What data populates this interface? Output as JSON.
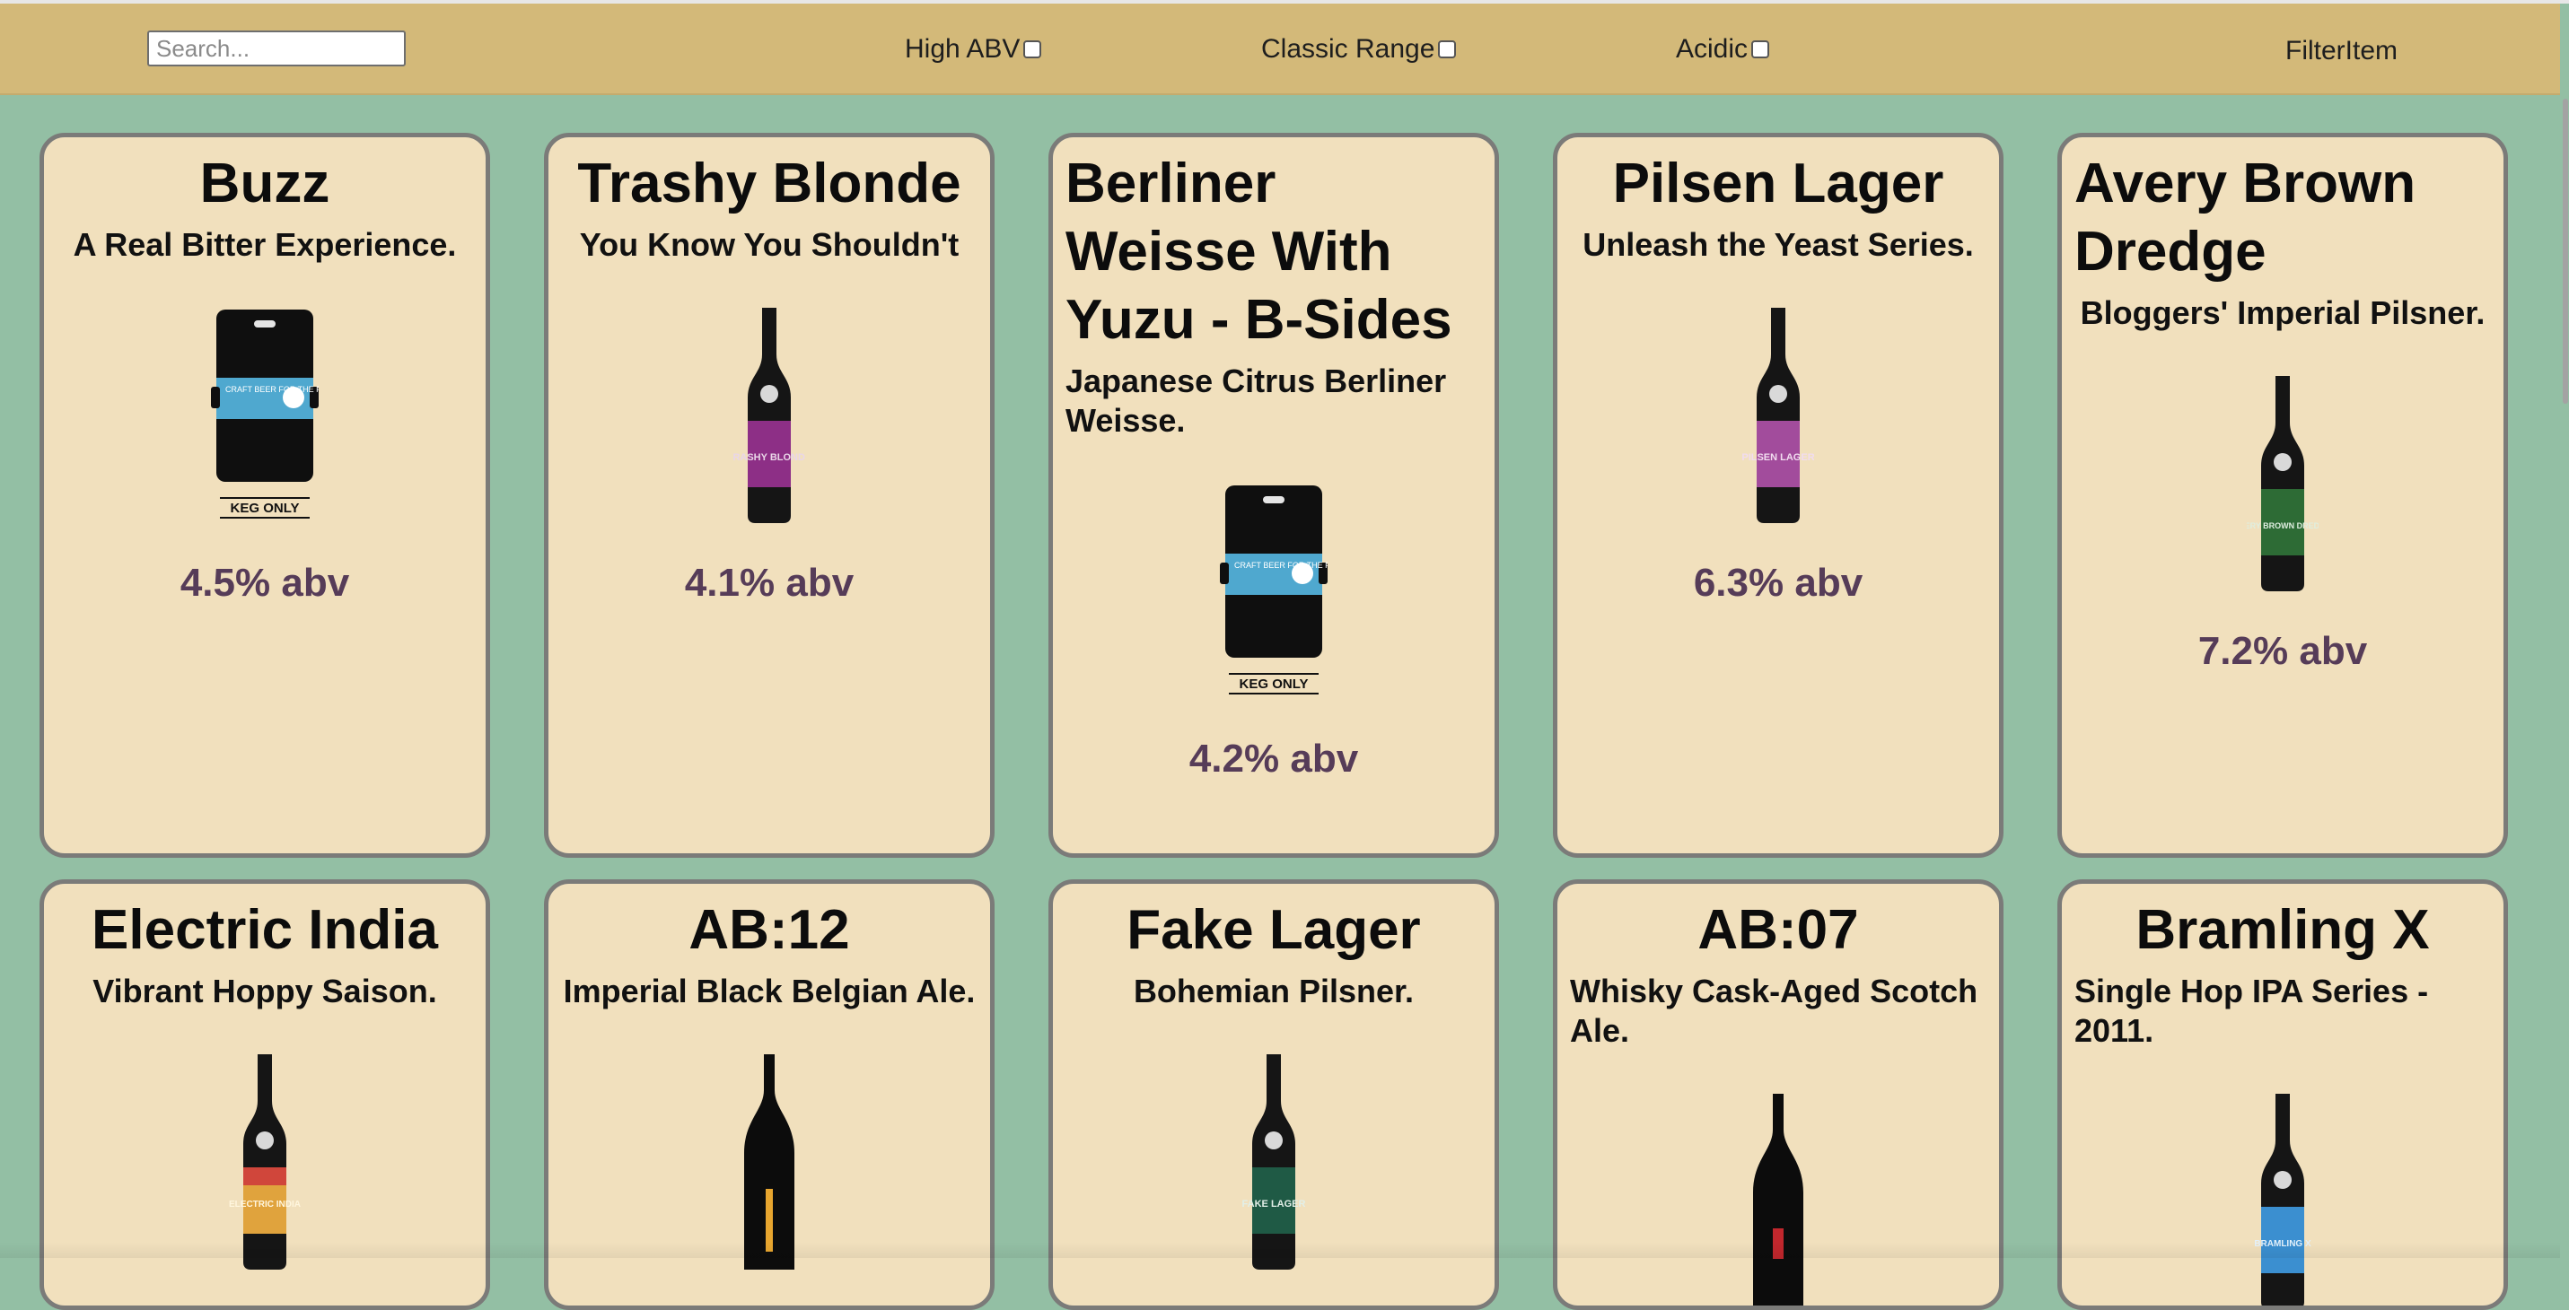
{
  "header": {
    "search_placeholder": "Search...",
    "filters": [
      {
        "label": "High ABV",
        "checked": false
      },
      {
        "label": "Classic Range",
        "checked": false
      },
      {
        "label": "Acidic",
        "checked": false
      }
    ],
    "title": "FilterItem"
  },
  "colors": {
    "background": "#93bfa4",
    "header": "#d3b979",
    "card": "#f1e0bd",
    "card_border": "#7b7b79",
    "abv_text": "#563c58"
  },
  "beers": [
    {
      "name": "Buzz",
      "tagline": "A Real Bitter Experience.",
      "abv": "4.5% abv",
      "image": "keg",
      "keg_label": "KEG ONLY",
      "keg_text": "CRAFT BEER FOR THE PEOPLE"
    },
    {
      "name": "Trashy Blonde",
      "tagline": "You Know You Shouldn't",
      "abv": "4.1% abv",
      "image": "bottle",
      "label_color": "#8d2f86",
      "label_text": "TRASHY BLONDE"
    },
    {
      "name": "Berliner Weisse With Yuzu - B-Sides",
      "tagline": "Japanese Citrus Berliner Weisse.",
      "abv": "4.2% abv",
      "image": "keg",
      "keg_label": "KEG ONLY",
      "keg_text": "CRAFT BEER FOR THE PEOPLE"
    },
    {
      "name": "Pilsen Lager",
      "tagline": "Unleash the Yeast Series.",
      "abv": "6.3% abv",
      "image": "bottle",
      "label_color": "#a24c9c",
      "label_text": "PILSEN LAGER"
    },
    {
      "name": "Avery Brown Dredge",
      "tagline": "Bloggers' Imperial Pilsner.",
      "abv": "7.2% abv",
      "image": "bottle",
      "label_color": "#2d6b35",
      "label_text": "AVERY BROWN DREDGE"
    },
    {
      "name": "Electric India",
      "tagline": "Vibrant Hoppy Saison.",
      "abv": "",
      "image": "bottle",
      "label_color": "#e0a33d",
      "label_text": "ELECTRIC INDIA"
    },
    {
      "name": "AB:12",
      "tagline": "Imperial Black Belgian Ale.",
      "abv": "",
      "image": "tallbottle",
      "label_color": "#e8a62f"
    },
    {
      "name": "Fake Lager",
      "tagline": "Bohemian Pilsner.",
      "abv": "",
      "image": "bottle",
      "label_color": "#1f5a45",
      "label_text": "FAKE LAGER"
    },
    {
      "name": "AB:07",
      "tagline": "Whisky Cask-Aged Scotch Ale.",
      "abv": "",
      "image": "tallbottle",
      "label_color": "#c2272d"
    },
    {
      "name": "Bramling X",
      "tagline": "Single Hop IPA Series - 2011.",
      "abv": "",
      "image": "bottle",
      "label_color": "#3b8fd0",
      "label_text": "BRAMLING X"
    }
  ]
}
